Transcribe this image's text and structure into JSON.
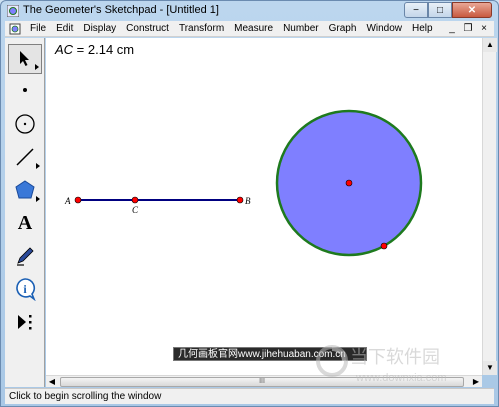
{
  "window": {
    "title": "The Geometer's Sketchpad - [Untitled 1]",
    "minimize_label": "−",
    "maximize_label": "□",
    "close_label": "✕"
  },
  "menubar": {
    "items": [
      "File",
      "Edit",
      "Display",
      "Construct",
      "Transform",
      "Measure",
      "Number",
      "Graph",
      "Window",
      "Help"
    ],
    "doc_minimize": "_",
    "doc_restore": "❐",
    "doc_close": "×"
  },
  "toolbox": {
    "tools": [
      "arrow-select-tool",
      "point-tool",
      "compass-tool",
      "straightedge-tool",
      "polygon-tool",
      "text-tool",
      "marker-tool",
      "information-tool",
      "custom-tool"
    ],
    "selected": "arrow-select-tool",
    "text_tool_glyph": "A"
  },
  "canvas": {
    "measurement": {
      "name": "AC",
      "equals": " = ",
      "value": "2.14 cm"
    },
    "segment": {
      "label_a": "A",
      "label_b": "B",
      "label_c": "C"
    },
    "colors": {
      "segment": "#000080",
      "point": "#ff0000",
      "circle_fill": "#7f7fff",
      "circle_stroke": "#1e7a1e"
    }
  },
  "hscroll": {
    "thumb_grip": "III"
  },
  "statusbar": {
    "text": "Click to begin scrolling the window"
  },
  "watermark": {
    "banner": "几何画板官网www.jihehuaban.com.cn",
    "logo_text": "当下软件园",
    "logo_url": "www.downxia.com"
  }
}
